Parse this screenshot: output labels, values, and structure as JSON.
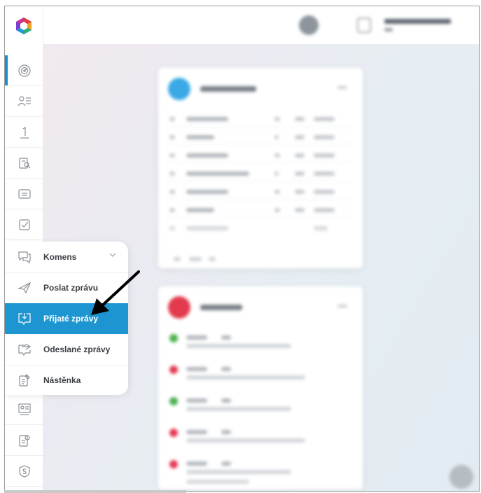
{
  "sidebar": {
    "items": [
      {
        "name": "dashboard-icon"
      },
      {
        "name": "students-icon"
      },
      {
        "name": "grades-icon",
        "text": "1"
      },
      {
        "name": "homework-icon"
      },
      {
        "name": "id-card-icon"
      },
      {
        "name": "checklist-icon"
      },
      {
        "name": "comments-icon"
      },
      {
        "name": "presentation-icon"
      },
      {
        "name": "document-settings-icon"
      },
      {
        "name": "shield-icon"
      }
    ]
  },
  "menu": {
    "header": "Komens",
    "items": [
      {
        "label": "Poslat zprávu",
        "icon": "send-icon"
      },
      {
        "label": "Přijaté zprávy",
        "icon": "inbox-icon",
        "selected": true
      },
      {
        "label": "Odeslané zprávy",
        "icon": "sent-icon"
      },
      {
        "label": "Nástěnka",
        "icon": "noticeboard-icon"
      }
    ]
  },
  "colors": {
    "accent": "#1c95d1",
    "card1_circle": "#3aa9e6",
    "card2_circle": "#e23a4c",
    "green": "#4caf50",
    "red": "#e53950"
  }
}
